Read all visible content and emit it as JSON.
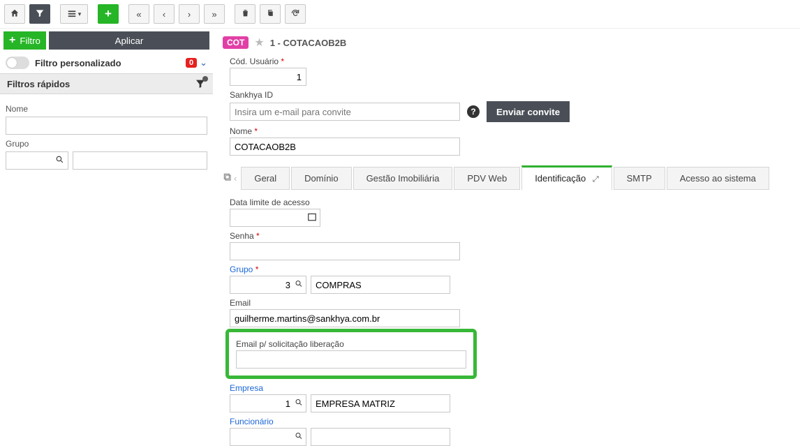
{
  "toolbar": {
    "filter_label": "Filtro",
    "apply_label": "Aplicar",
    "personalized_label": "Filtro personalizado",
    "personalized_badge": "0",
    "quick_filters_header": "Filtros rápidos",
    "f_name_label": "Nome",
    "f_group_label": "Grupo"
  },
  "record": {
    "badge": "COT",
    "title": "1 - COTACAOB2B",
    "cod_usuario_label": "Cód. Usuário",
    "cod_usuario_value": "1",
    "sankhya_id_label": "Sankhya ID",
    "sankhya_placeholder": "Insira um e-mail para convite",
    "invite_label": "Enviar convite",
    "nome_label": "Nome",
    "nome_value": "COTACAOB2B"
  },
  "tabs": {
    "items": [
      "Geral",
      "Domínio",
      "Gestão Imobiliária",
      "PDV Web",
      "Identificação",
      "SMTP",
      "Acesso ao sistema"
    ],
    "active_index": 4
  },
  "ident": {
    "data_limite_label": "Data limite de acesso",
    "senha_label": "Senha",
    "grupo_label": "Grupo",
    "grupo_code": "3",
    "grupo_desc": "COMPRAS",
    "email_label": "Email",
    "email_value": "guilherme.martins@sankhya.com.br",
    "email_liberacao_label": "Email p/ solicitação liberação",
    "email_liberacao_value": "",
    "empresa_label": "Empresa",
    "empresa_code": "1",
    "empresa_desc": "EMPRESA MATRIZ",
    "funcionario_label": "Funcionário"
  }
}
